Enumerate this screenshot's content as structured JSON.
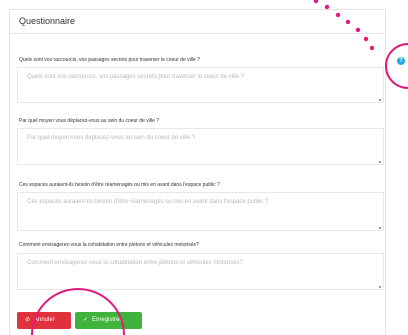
{
  "panel": {
    "title": "Questionnaire"
  },
  "questions": [
    {
      "label": "Quels sont vos raccourcis, vos passages secrets pour traverser le coeur de ville ?",
      "placeholder": "Quels sont vos raccourcis, vos passages secrets pour traverser le coeur de ville ?"
    },
    {
      "label": "Par quel moyen vous déplacez-vous au sein du coeur de ville ?",
      "placeholder": "Par quel moyen vous deplacez-vous au sein du coeur de ville ?"
    },
    {
      "label": "Ces espaces auraient-ils besoin d'être réaménagés ou mis en avant dans l'espace public ?",
      "placeholder": "Ces espaces auraient-ils besoin d'être réaménagés ou mis en avant dans l'espace public ?"
    },
    {
      "label": "Comment envisagerez-vous la cohabitation entre piétons et véhicules motorisés?",
      "placeholder": "Comment envisagerez-vous la cohabitation entre piétons et véhicules motorisés?"
    }
  ],
  "buttons": {
    "cancel_label": "Annuler",
    "save_label": "Enregistrer"
  },
  "help": {
    "icon_glyph": "?"
  },
  "colors": {
    "cancel": "#e0323c",
    "save": "#3fb33b",
    "help": "#27a8df",
    "annotation": "#e0197a"
  },
  "icons": {
    "cancel": "prohibited-icon",
    "save": "check-icon",
    "help": "question-mark-icon"
  }
}
